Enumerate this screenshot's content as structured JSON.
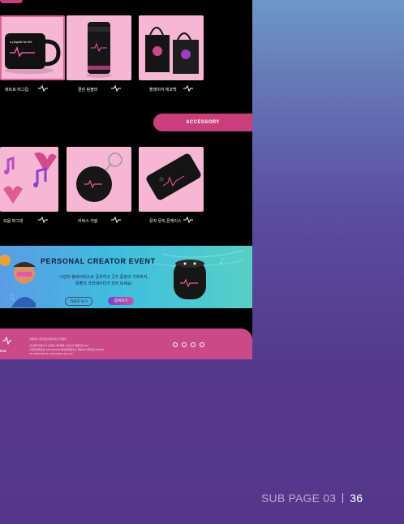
{
  "products_row1": [
    {
      "caption": "레트로 머그컵"
    },
    {
      "caption": "클린 텀블러"
    },
    {
      "caption": "플레이어 에코백"
    }
  ],
  "accessory_label": "ACCESSORY",
  "products_row2": [
    {
      "caption": "모음 마그넷"
    },
    {
      "caption": "러버스 키링"
    },
    {
      "caption": "뮤직 뮤직 폰케이스"
    }
  ],
  "banner": {
    "title": "PERSONAL CREATOR  EVENT",
    "subtitle_line1": "나만의 플레이리스트 공유하고 굿즈 증정의 기회까지,",
    "subtitle_line2": "뮤플의 크리에이터가 되어 보세요!",
    "btn_more": "자세히 보기",
    "btn_join": "참여하기"
  },
  "footer": {
    "logo": "PLE",
    "links": "회원약관   개인정보처리방침   고객센터",
    "info1": "(주)뮤플  대표이사 홍길동  서울특별시 강남구 테헤란로 000",
    "info2": "사업자등록번호 000-00-00000  통신판매업신고 제0000-서울강남-0000호",
    "info3": "TEL 0000-0000   E-mail help@muple.com"
  },
  "page_label": "SUB PAGE 03",
  "page_number": "36",
  "colors": {
    "accent": "#c93f7c",
    "card": "#f5b7d2",
    "panel": "#000000"
  }
}
